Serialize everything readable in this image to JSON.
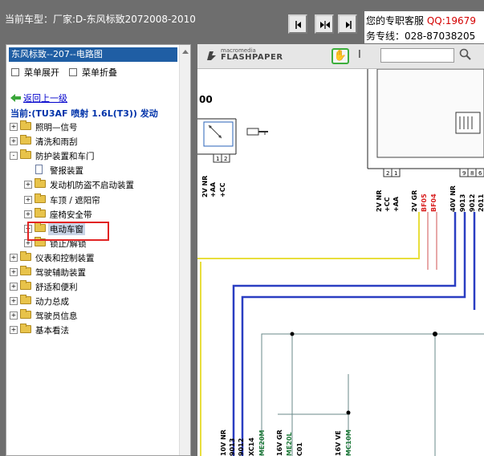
{
  "header": {
    "car_type": "当前车型：厂家:D-东风标致2072008-2010",
    "service_label": "您的专职客服",
    "service_qq": "QQ:19679",
    "service_phone": "务专线：028-87038205"
  },
  "left_panel": {
    "title": "东风标致--207--电路图",
    "menu_expand": "菜单展开",
    "menu_collapse": "菜单折叠",
    "back_link": "返回上一级",
    "current": "当前:(TU3AF 喷射 1.6L(T3)) 发动",
    "tree": [
      {
        "label": "照明—信号",
        "level": 0,
        "expander": "+",
        "icon": "folder"
      },
      {
        "label": "清洗和雨刮",
        "level": 0,
        "expander": "+",
        "icon": "folder"
      },
      {
        "label": "防护装置和车门",
        "level": 0,
        "expander": "-",
        "icon": "folder"
      },
      {
        "label": "警报装置",
        "level": 1,
        "expander": "",
        "icon": "document"
      },
      {
        "label": "发动机防盗不启动装置",
        "level": 1,
        "expander": "+",
        "icon": "folder"
      },
      {
        "label": "车顶 / 遮阳帘",
        "level": 1,
        "expander": "+",
        "icon": "folder"
      },
      {
        "label": "座椅安全带",
        "level": 1,
        "expander": "+",
        "icon": "folder"
      },
      {
        "label": "电动车窗",
        "level": 1,
        "expander": "+",
        "icon": "folder",
        "selected": true
      },
      {
        "label": "锁止/解锁",
        "level": 1,
        "expander": "+",
        "icon": "folder"
      },
      {
        "label": "仪表和控制装置",
        "level": 0,
        "expander": "+",
        "icon": "folder"
      },
      {
        "label": "驾驶辅助装置",
        "level": 0,
        "expander": "+",
        "icon": "folder"
      },
      {
        "label": "舒适和便利",
        "level": 0,
        "expander": "+",
        "icon": "folder"
      },
      {
        "label": "动力总成",
        "level": 0,
        "expander": "+",
        "icon": "folder"
      },
      {
        "label": "驾驶员信息",
        "level": 0,
        "expander": "+",
        "icon": "folder"
      },
      {
        "label": "基本看法",
        "level": 0,
        "expander": "+",
        "icon": "folder"
      }
    ]
  },
  "viewer": {
    "brand_small": "macromedia",
    "brand_big": "FLASHPAPER",
    "search_value": "",
    "diagram": {
      "box_label": "00",
      "pins_left": [
        "1",
        "2"
      ],
      "pins_mid": [
        "2",
        "1"
      ],
      "pins_right": [
        "9",
        "8",
        "6"
      ],
      "wires_left": [
        "2V NR",
        "+AA",
        "+CC"
      ],
      "wires_mid": [
        "2V NR",
        "+CC",
        "+AA"
      ],
      "wire_mid_red": "2V GR",
      "codes_red": [
        "BF05",
        "BF04"
      ],
      "wire_right": "40V NR",
      "wires_right": [
        "9013",
        "9012",
        "2011"
      ],
      "bottom_labels": [
        "10V NR",
        "9013",
        "9012",
        "XC14",
        "ME20M",
        "16V GR",
        "ME20L",
        "C01",
        "16V VE",
        "MC10M"
      ]
    }
  }
}
